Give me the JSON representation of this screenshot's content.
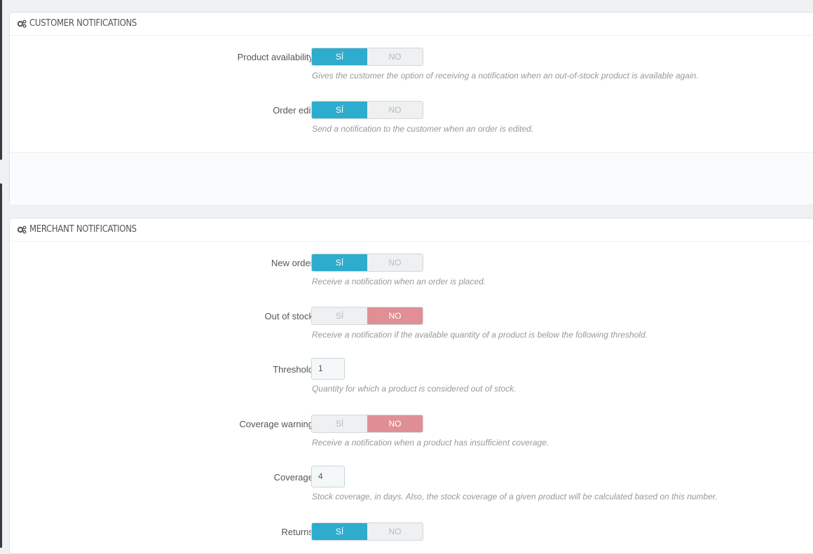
{
  "customer_panel": {
    "title": "CUSTOMER NOTIFICATIONS",
    "fields": [
      {
        "label": "Product availability",
        "yes": "SÍ",
        "no": "NO",
        "value": "yes",
        "help": "Gives the customer the option of receiving a notification when an out-of-stock product is available again."
      },
      {
        "label": "Order edit",
        "yes": "SÍ",
        "no": "NO",
        "value": "yes",
        "help": "Send a notification to the customer when an order is edited."
      }
    ]
  },
  "merchant_panel": {
    "title": "MERCHANT NOTIFICATIONS",
    "new_order": {
      "label": "New order",
      "yes": "SÍ",
      "no": "NO",
      "value": "yes",
      "help": "Receive a notification when an order is placed."
    },
    "out_of_stock": {
      "label": "Out of stock",
      "yes": "SÍ",
      "no": "NO",
      "value": "no",
      "help": "Receive a notification if the available quantity of a product is below the following threshold."
    },
    "threshold": {
      "label": "Threshold",
      "value": "1",
      "help": "Quantity for which a product is considered out of stock."
    },
    "coverage_warning": {
      "label": "Coverage warning",
      "yes": "SÍ",
      "no": "NO",
      "value": "no",
      "help": "Receive a notification when a product has insufficient coverage."
    },
    "coverage": {
      "label": "Coverage",
      "value": "4",
      "help": "Stock coverage, in days. Also, the stock coverage of a given product will be calculated based on this number."
    },
    "returns": {
      "label": "Returns",
      "yes": "SÍ",
      "no": "NO",
      "value": "yes"
    }
  },
  "colors": {
    "accent": "#2eacce",
    "no_active": "#e08f95"
  },
  "icons": {
    "panel_heading": "cogs-icon"
  }
}
